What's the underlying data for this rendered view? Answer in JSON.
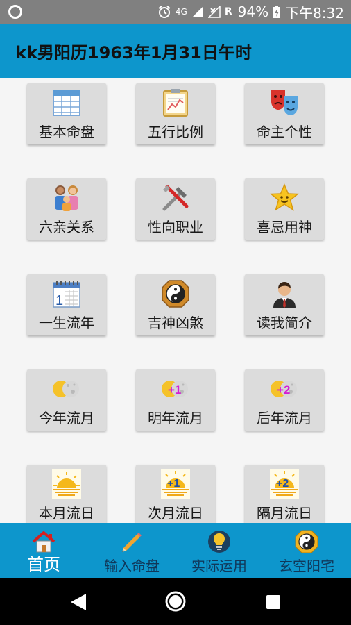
{
  "status_bar": {
    "network": "4G",
    "carrier_letter": "R",
    "battery": "94%",
    "time": "下午8:32"
  },
  "header": {
    "title": "kk男阳历1963年1月31日午时"
  },
  "grid": {
    "items": [
      {
        "label": "基本命盘",
        "icon": "table-icon"
      },
      {
        "label": "五行比例",
        "icon": "chart-clipboard-icon"
      },
      {
        "label": "命主个性",
        "icon": "theater-masks-icon"
      },
      {
        "label": "六亲关系",
        "icon": "family-icon"
      },
      {
        "label": "性向职业",
        "icon": "tools-icon"
      },
      {
        "label": "喜忌用神",
        "icon": "star-icon"
      },
      {
        "label": "一生流年",
        "icon": "calendar-icon"
      },
      {
        "label": "吉神凶煞",
        "icon": "yin-yang-icon"
      },
      {
        "label": "读我简介",
        "icon": "person-icon"
      },
      {
        "label": "今年流月",
        "icon": "sun-moon-icon"
      },
      {
        "label": "明年流月",
        "icon": "sun-moon-plus1-icon"
      },
      {
        "label": "后年流月",
        "icon": "sun-moon-plus2-icon"
      },
      {
        "label": "本月流日",
        "icon": "sunrise-icon"
      },
      {
        "label": "次月流日",
        "icon": "sunrise-plus1-icon"
      },
      {
        "label": "隔月流日",
        "icon": "sunrise-plus2-icon"
      }
    ],
    "badge_plus1": "+1",
    "badge_plus2": "+2",
    "calendar_day": "1"
  },
  "bottom_nav": {
    "items": [
      {
        "label": "首页",
        "icon": "home-icon",
        "active": true
      },
      {
        "label": "输入命盘",
        "icon": "pencil-icon",
        "active": false
      },
      {
        "label": "实际运用",
        "icon": "lightbulb-icon",
        "active": false
      },
      {
        "label": "玄空阳宅",
        "icon": "yin-yang-icon",
        "active": false
      }
    ]
  },
  "colors": {
    "status_bar": "#808080",
    "primary": "#0d96cc",
    "tile": "#dcdcdc",
    "nav_text": "#10385a",
    "nav_active_text": "#ffffff"
  }
}
